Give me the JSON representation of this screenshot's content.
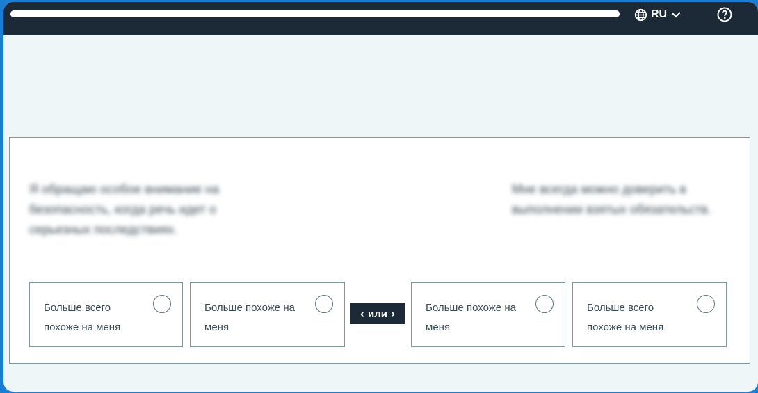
{
  "header": {
    "progress": 1.0,
    "language_label": "RU",
    "icons": {
      "language": "globe-icon",
      "dropdown": "chevron-down-icon",
      "help": "help-circle-icon"
    }
  },
  "question": {
    "left_statement": "Я обращаю особое внимание на безопасность, когда речь идет о серьезных последствиях.",
    "right_statement": "Мне всегда можно доверить в выполнении взятых обязательств.",
    "options": [
      {
        "label": "Больше всего похоже на меня"
      },
      {
        "label": "Больше похоже на меня"
      },
      {
        "label": "Больше похоже на меня"
      },
      {
        "label": "Больше всего похоже на меня"
      }
    ],
    "or_label": "или"
  },
  "colors": {
    "page_border": "#1a7fd4",
    "header_bg": "#1c2a38",
    "content_bg": "#eef6f8",
    "card_border": "#7e9aa0"
  }
}
